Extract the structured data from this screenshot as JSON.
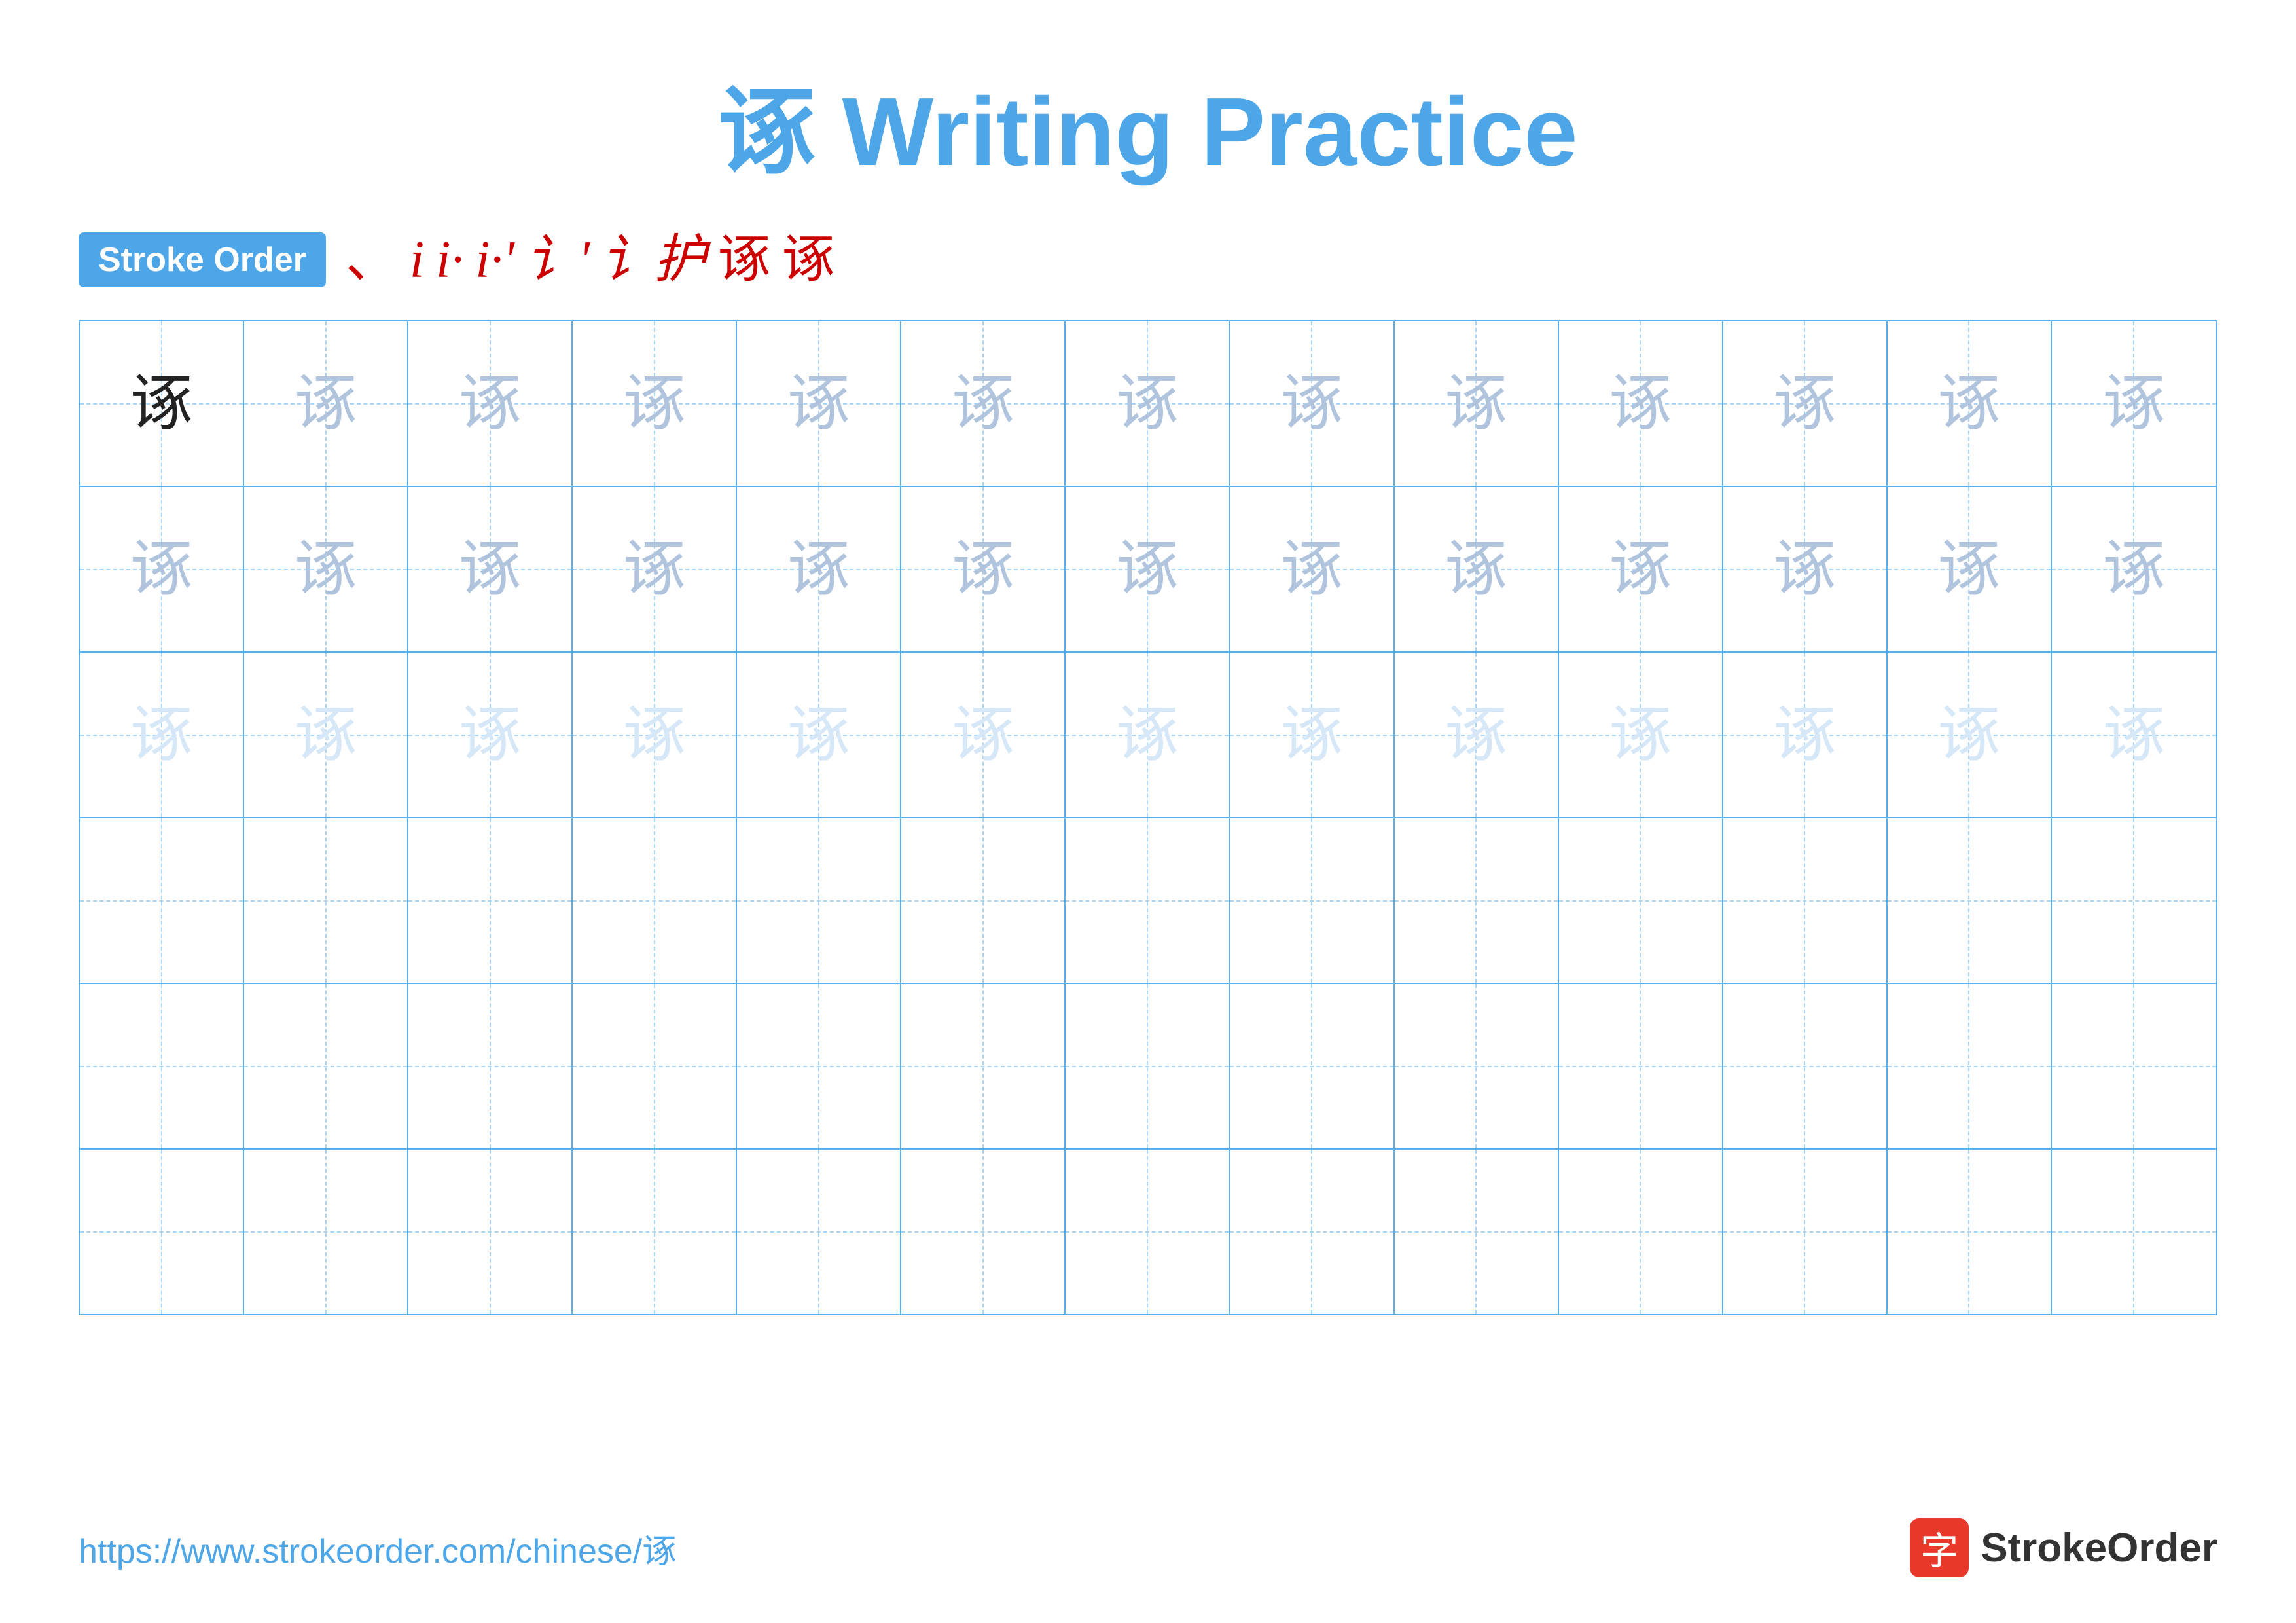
{
  "title": "诼 Writing Practice",
  "stroke_order": {
    "badge_label": "Stroke Order",
    "strokes": [
      "、",
      "i",
      "i·",
      "i·'",
      "i·'r",
      "i·'r护",
      "诼",
      "诼"
    ]
  },
  "character": "诼",
  "grid": {
    "rows": 6,
    "cols": 13,
    "row_types": [
      "dark_then_medium",
      "light",
      "lighter",
      "empty",
      "empty",
      "empty"
    ]
  },
  "footer": {
    "url": "https://www.strokeorder.com/chinese/诼",
    "logo_text": "StrokeOrder",
    "logo_char": "字"
  }
}
